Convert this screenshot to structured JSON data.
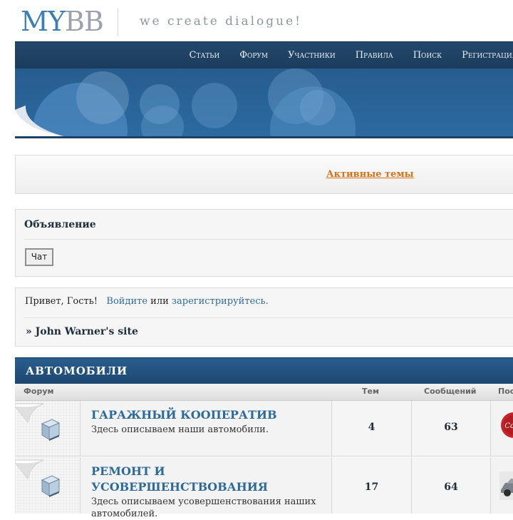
{
  "logo": {
    "part1": "MY",
    "part2": "BB",
    "tagline": "we create dialogue!"
  },
  "nav": [
    {
      "label": "Статьи"
    },
    {
      "label": "Форум"
    },
    {
      "label": "Участники"
    },
    {
      "label": "Правила"
    },
    {
      "label": "Поиск"
    },
    {
      "label": "Регистрация"
    }
  ],
  "active_topics": {
    "label": "Активные темы"
  },
  "announcement": {
    "title": "Объявление",
    "chat_button": "Чат"
  },
  "welcome": {
    "greeting": "Привет, Гость!",
    "login_link": "Войдите",
    "or_text": "или",
    "register_link": "зарегистрируйтесь.",
    "site_link": "» John Warner's site"
  },
  "category": {
    "title": "АВТОМОБИЛИ",
    "columns": {
      "forum": "Форум",
      "topics": "Тем",
      "posts": "Сообщений",
      "last_post": "Пос"
    },
    "forums": [
      {
        "name": "Гаражный кооператив",
        "description": "Здесь описываем наши автомобили.",
        "topics": "4",
        "posts": "63"
      },
      {
        "name_line1": "Ремонт и",
        "name_line2": "усовершенствования",
        "description_line1": "Здесь описываем усовершенствования наших",
        "description_line2": "автомобилей.",
        "topics": "17",
        "posts": "64"
      }
    ]
  },
  "colors": {
    "nav_bg": "#1b3c5c",
    "banner_bg": "#2a6599",
    "link": "#2d6a99",
    "active_link": "#d5721a"
  }
}
